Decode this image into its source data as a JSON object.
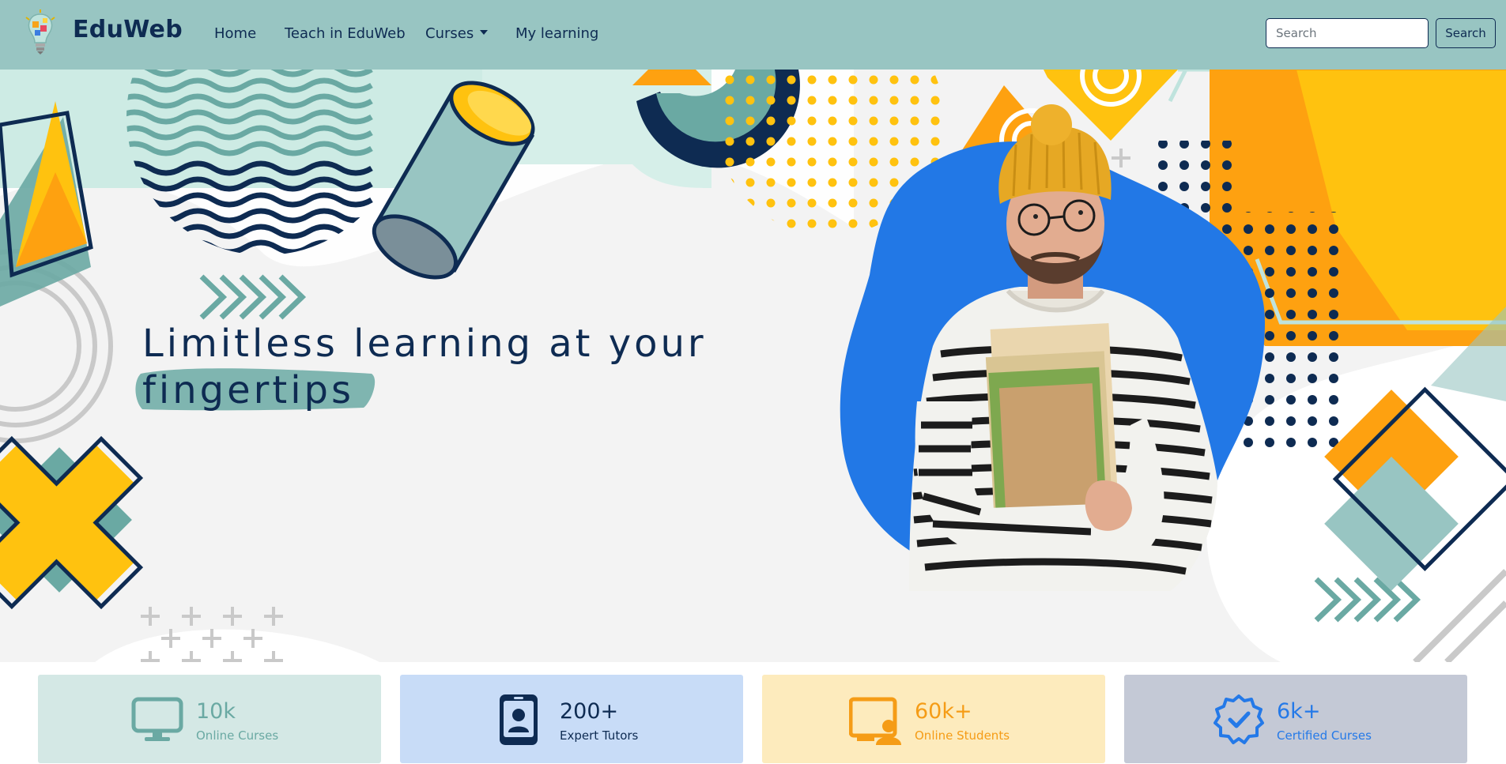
{
  "navbar": {
    "brand": "EduWeb",
    "links": [
      "Home",
      "Teach in EduWeb",
      "Curses",
      "My learning"
    ],
    "search_placeholder": "Search",
    "search_button": "Search"
  },
  "hero": {
    "title": "Limitless learning at your fingertips"
  },
  "stats": [
    {
      "value": "10k",
      "label": "Online Curses",
      "icon": "monitor-icon",
      "bg": "#d4e8e5",
      "color": "#6aa9a3"
    },
    {
      "value": "200+",
      "label": "Expert Tutors",
      "icon": "phone-user-icon",
      "bg": "#c8dcf7",
      "color": "#0e2b52"
    },
    {
      "value": "60k+",
      "label": "Online Students",
      "icon": "presentation-user-icon",
      "bg": "#fdebbd",
      "color": "#f59c16"
    },
    {
      "value": "6k+",
      "label": "Certified Curses",
      "icon": "verified-badge-icon",
      "bg": "#c4c9d6",
      "color": "#2479e8"
    }
  ],
  "colors": {
    "navbar": "#98c5c2",
    "navy": "#0e2b52",
    "teal": "#6aa9a3",
    "orange": "#fea110",
    "yellow": "#ffc20f",
    "blue_blob": "#2278e6"
  }
}
